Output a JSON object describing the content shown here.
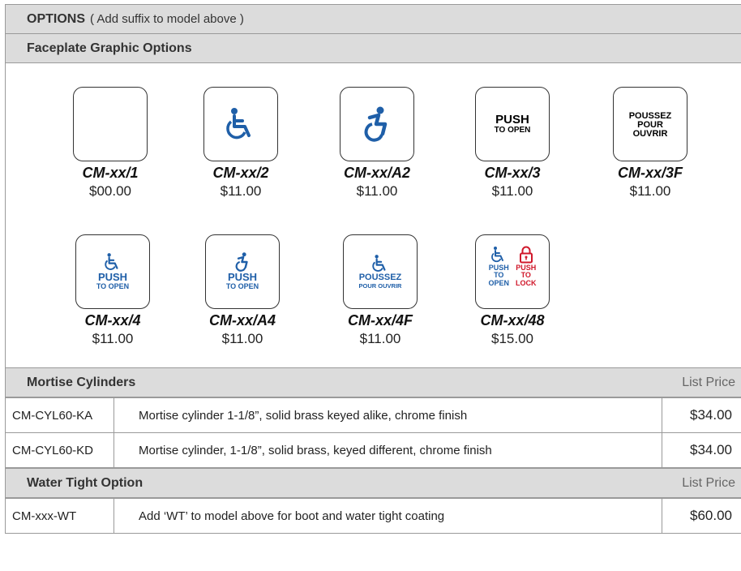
{
  "options": {
    "label": "OPTIONS",
    "note": "( Add suffix to model above )"
  },
  "faceplate": {
    "title": "Faceplate Graphic Options",
    "items": [
      {
        "model": "CM-xx/1",
        "price": "$00.00",
        "icon": "blank-faceplate"
      },
      {
        "model": "CM-xx/2",
        "price": "$11.00",
        "icon": "wheelchair-icon"
      },
      {
        "model": "CM-xx/A2",
        "price": "$11.00",
        "icon": "accessible-active-icon"
      },
      {
        "model": "CM-xx/3",
        "price": "$11.00",
        "icon": "push-text",
        "lines": [
          "PUSH",
          "TO OPEN"
        ]
      },
      {
        "model": "CM-xx/3F",
        "price": "$11.00",
        "icon": "poussez-text",
        "lines": [
          "POUSSEZ",
          "POUR",
          "OUVRIR"
        ]
      },
      {
        "model": "CM-xx/4",
        "price": "$11.00",
        "icon": "wheelchair-icon",
        "lines": [
          "PUSH",
          "TO OPEN"
        ]
      },
      {
        "model": "CM-xx/A4",
        "price": "$11.00",
        "icon": "accessible-active-icon",
        "lines": [
          "PUSH",
          "TO OPEN"
        ]
      },
      {
        "model": "CM-xx/4F",
        "price": "$11.00",
        "icon": "wheelchair-icon",
        "lines": [
          "POUSSEZ",
          "POUR OUVRIR"
        ]
      },
      {
        "model": "CM-xx/48",
        "price": "$15.00",
        "icon": "wheelchair-and-lock-icon",
        "lines_left": [
          "PUSH",
          "TO",
          "OPEN"
        ],
        "lines_right": [
          "PUSH",
          "TO",
          "LOCK"
        ]
      }
    ]
  },
  "mortise": {
    "title": "Mortise Cylinders",
    "list_price": "List Price",
    "rows": [
      {
        "code": "CM-CYL60-KA",
        "desc": "Mortise cylinder 1-1/8”, solid brass keyed alike, chrome finish",
        "price": "$34.00"
      },
      {
        "code": "CM-CYL60-KD",
        "desc": "Mortise cylinder, 1-1/8”, solid brass, keyed different, chrome finish",
        "price": "$34.00"
      }
    ]
  },
  "watertight": {
    "title": "Water Tight Option",
    "list_price": "List Price",
    "rows": [
      {
        "code": "CM-xxx-WT",
        "desc": "Add ‘WT’ to model above for boot and water tight coating",
        "price": "$60.00"
      }
    ]
  },
  "colors": {
    "blue": "#1f5fa8",
    "red": "#d0182b",
    "header_gray": "#dcdcdc"
  }
}
